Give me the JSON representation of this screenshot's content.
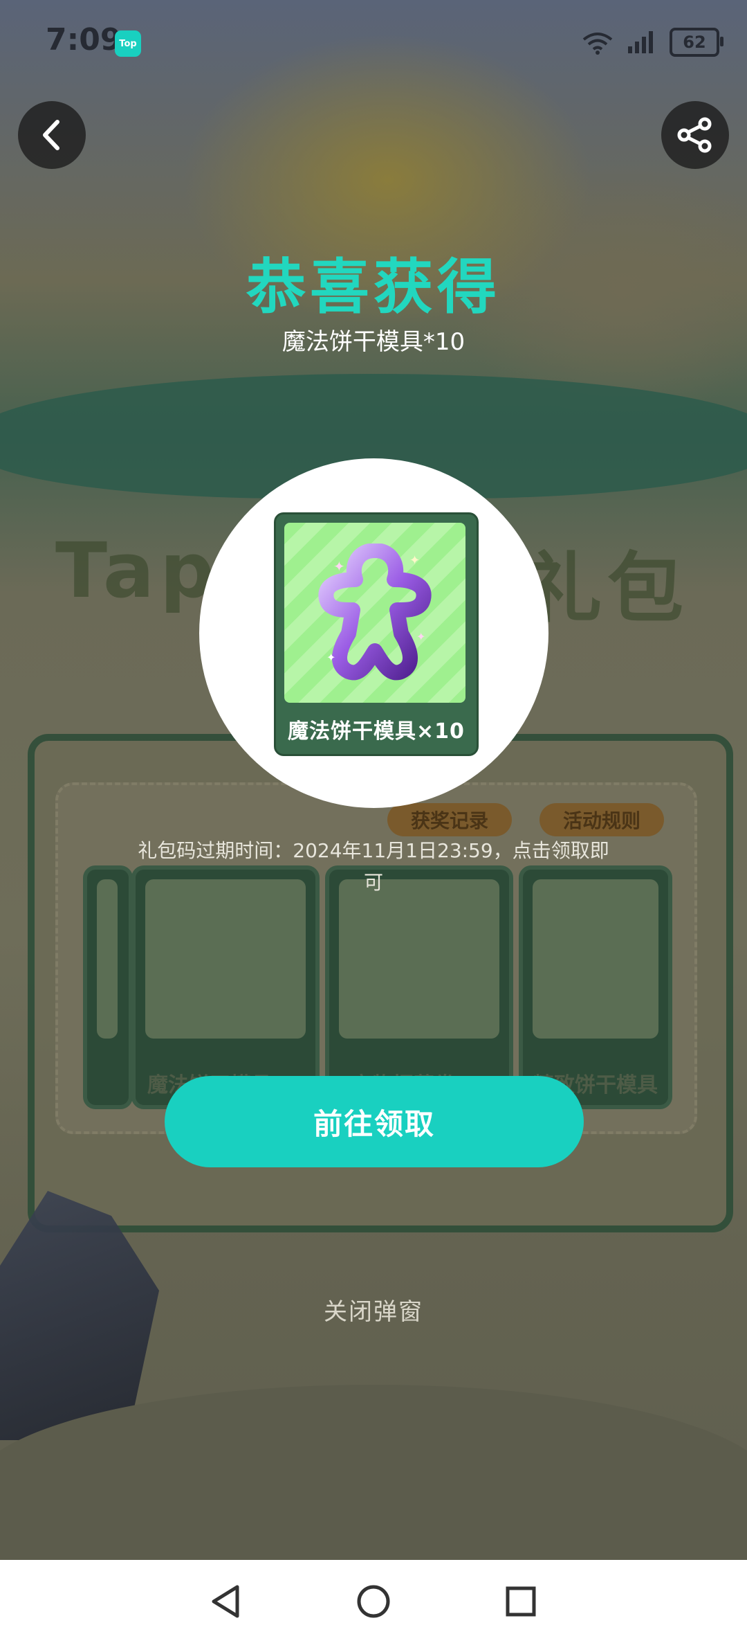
{
  "status_bar": {
    "time": "7:09",
    "app_badge": "Top",
    "battery": "62"
  },
  "popup": {
    "title": "恭喜获得",
    "item_name": "魔法饼干模具*10",
    "card_label": "魔法饼干模具×10",
    "expiry_text": "礼包码过期时间：2024年11月1日23:59，点击领取即可",
    "claim_button": "前往领取",
    "close_button": "关闭弹窗"
  },
  "background": {
    "banner_left": "Tap",
    "banner_right": "礼包",
    "tabs": [
      "获奖记录",
      "活动规则"
    ],
    "cards": [
      "魔法饼干模具×1",
      "宝物招募卷×1",
      "精致饼干模具"
    ]
  },
  "colors": {
    "accent": "#19d0c0",
    "title": "#22d7bf"
  },
  "icons": {
    "back": "chevron-left-icon",
    "share": "share-icon",
    "nav_back": "triangle-back-icon",
    "nav_home": "circle-home-icon",
    "nav_recent": "square-recent-icon"
  }
}
